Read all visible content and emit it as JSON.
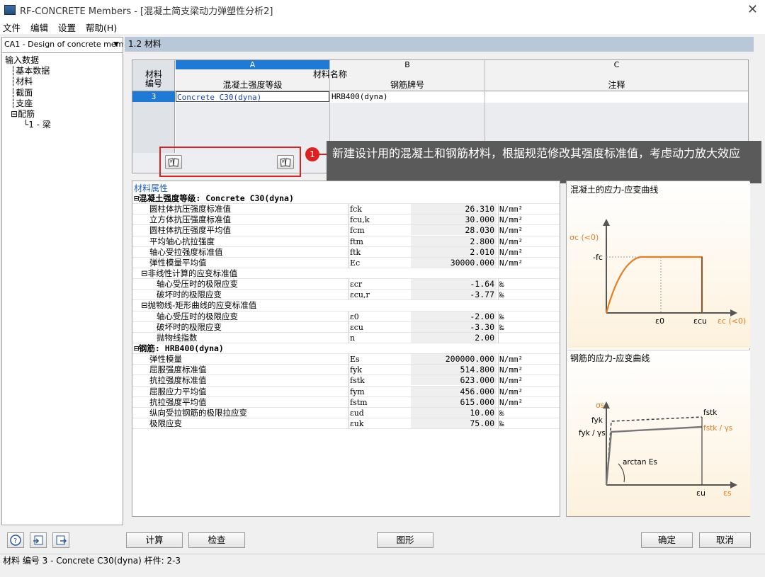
{
  "window": {
    "title": "RF-CONCRETE Members - [混凝土简支梁动力弹塑性分析2]",
    "close_glyph": "✕"
  },
  "menu": [
    "文件",
    "编辑",
    "设置",
    "帮助(H)"
  ],
  "navigator": {
    "case_select": "CA1 - Design of concrete mem",
    "tree": [
      "输入数据",
      "基本数据",
      "材料",
      "截面",
      "支座",
      "配筋",
      "1 - 梁"
    ]
  },
  "section_title": "1.2 材料",
  "grid": {
    "col_letters": [
      "A",
      "B",
      "C"
    ],
    "row_header": "材料\n编号",
    "group_header": "材料名称",
    "col_headers": [
      "混凝土强度等级",
      "钢筋牌号",
      "注释"
    ],
    "rows": [
      {
        "no": "3",
        "concrete": "Concrete C30(dyna)",
        "steel": "HRB400(dyna)",
        "comment": ""
      }
    ]
  },
  "callout": {
    "number": "1",
    "text": "新建设计用的混凝土和钢筋材料，根据规范修改其强度标准值，考虑动力放大效应"
  },
  "properties": {
    "title": "材料属性",
    "rows": [
      {
        "type": "group",
        "name": "⊟混凝土强度等级: Concrete C30(dyna)"
      },
      {
        "type": "item",
        "indent": 1,
        "name": "圆柱体抗压强度标准值",
        "sym": "fck",
        "val": "26.310",
        "unit": "N/mm²"
      },
      {
        "type": "item",
        "indent": 1,
        "name": "立方体抗压强度标准值",
        "sym": "fcu,k",
        "val": "30.000",
        "unit": "N/mm²"
      },
      {
        "type": "item",
        "indent": 1,
        "name": "圆柱体抗压强度平均值",
        "sym": "fcm",
        "val": "28.030",
        "unit": "N/mm²"
      },
      {
        "type": "item",
        "indent": 1,
        "name": "平均轴心抗拉强度",
        "sym": "ftm",
        "val": "2.800",
        "unit": "N/mm²"
      },
      {
        "type": "item",
        "indent": 1,
        "name": "轴心受拉强度标准值",
        "sym": "ftk",
        "val": "2.010",
        "unit": "N/mm²"
      },
      {
        "type": "item",
        "indent": 1,
        "name": "弹性模量平均值",
        "sym": "Ec",
        "val": "30000.000",
        "unit": "N/mm²"
      },
      {
        "type": "sub",
        "name": "⊟非线性计算的应变标准值"
      },
      {
        "type": "item",
        "indent": 2,
        "name": "轴心受压时的极限应变",
        "sym": "εcr",
        "val": "-1.64",
        "unit": "‰"
      },
      {
        "type": "item",
        "indent": 2,
        "name": "破坏时的极限应变",
        "sym": "εcu,r",
        "val": "-3.77",
        "unit": "‰"
      },
      {
        "type": "sub",
        "name": "⊟抛物线-矩形曲线的应变标准值"
      },
      {
        "type": "item",
        "indent": 2,
        "name": "轴心受压时的极限应变",
        "sym": "ε0",
        "val": "-2.00",
        "unit": "‰"
      },
      {
        "type": "item",
        "indent": 2,
        "name": "破坏时的极限应变",
        "sym": "εcu",
        "val": "-3.30",
        "unit": "‰"
      },
      {
        "type": "item",
        "indent": 2,
        "name": "抛物线指数",
        "sym": "n",
        "val": "2.00",
        "unit": ""
      },
      {
        "type": "group",
        "name": "⊟钢筋: HRB400(dyna)"
      },
      {
        "type": "item",
        "indent": 1,
        "name": "弹性模量",
        "sym": "Es",
        "val": "200000.000",
        "unit": "N/mm²"
      },
      {
        "type": "item",
        "indent": 1,
        "name": "屈服强度标准值",
        "sym": "fyk",
        "val": "514.800",
        "unit": "N/mm²"
      },
      {
        "type": "item",
        "indent": 1,
        "name": "抗拉强度标准值",
        "sym": "fstk",
        "val": "623.000",
        "unit": "N/mm²"
      },
      {
        "type": "item",
        "indent": 1,
        "name": "屈服应力平均值",
        "sym": "fym",
        "val": "456.000",
        "unit": "N/mm²"
      },
      {
        "type": "item",
        "indent": 1,
        "name": "抗拉强度平均值",
        "sym": "fstm",
        "val": "615.000",
        "unit": "N/mm²"
      },
      {
        "type": "item",
        "indent": 1,
        "name": "纵向受拉钢筋的极限拉应变",
        "sym": "εud",
        "val": "10.00",
        "unit": "‰"
      },
      {
        "type": "item",
        "indent": 1,
        "name": "极限应变",
        "sym": "εuk",
        "val": "75.00",
        "unit": "‰"
      }
    ]
  },
  "figures": {
    "concrete_title": "混凝土的应力-应变曲线",
    "concrete": {
      "y_axis": "σc (<0)",
      "y_mark": "-fc",
      "x_axis": "εc (<0)",
      "x_mark1": "ε0",
      "x_mark2": "εcu"
    },
    "steel_title": "钢筋的应力-应变曲线",
    "steel": {
      "y_axis": "σs",
      "fyk": "fyk",
      "fyk_gamma": "fyk / γs",
      "fstk": "fstk",
      "fstk_gamma": "fstk / γs",
      "slope": "arctan Es",
      "eps_u": "εu",
      "x_axis": "εs"
    }
  },
  "buttons": {
    "calc": "计算",
    "check": "检查",
    "graphics": "图形",
    "ok": "确定",
    "cancel": "取消"
  },
  "status": "材料 编号 3  -  Concrete C30(dyna) 杆件: 2-3",
  "colors": {
    "selected_header": "#1e7ad6",
    "callout_bg": "#5a5a5a",
    "highlight": "#e02020",
    "curve": "#e67e22"
  }
}
